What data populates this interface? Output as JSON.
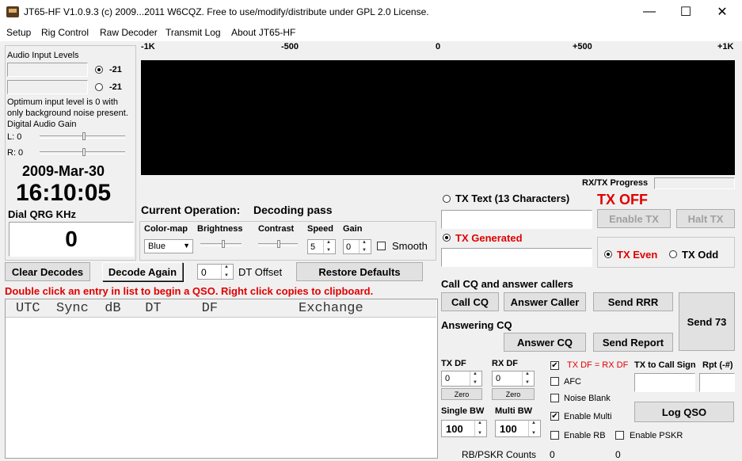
{
  "window": {
    "title": "JT65-HF V1.0.9.3 (c) 2009...2011 W6CQZ.  Free to use/modify/distribute under GPL 2.0 License.",
    "minimize": "—",
    "maximize": "☐",
    "close": "✕"
  },
  "menu": [
    "Setup",
    "Rig Control",
    "Raw Decoder",
    "Transmit Log",
    "About JT65-HF"
  ],
  "audio": {
    "title": "Audio Input Levels",
    "level1": "-21",
    "level2": "-21",
    "note": "Optimum input level is 0 with only background noise present.",
    "gain_title": "Digital Audio Gain",
    "left_label": "L: 0",
    "right_label": "R: 0"
  },
  "clock": {
    "date": "2009-Mar-30",
    "time": "16:10:05",
    "dial_label": "Dial QRG KHz",
    "dial_value": "0"
  },
  "waterfall": {
    "scale": [
      "-1K",
      "-500",
      "0",
      "+500",
      "+1K"
    ],
    "progress_label": "RX/TX Progress"
  },
  "operation": {
    "label": "Current Operation:",
    "value": "Decoding pass"
  },
  "controls": {
    "colormap_label": "Color-map",
    "colormap_value": "Blue",
    "brightness_label": "Brightness",
    "contrast_label": "Contrast",
    "speed_label": "Speed",
    "speed_value": "5",
    "gain_label": "Gain",
    "gain_value": "0",
    "smooth_label": "Smooth"
  },
  "decode": {
    "clear": "Clear Decodes",
    "again": "Decode Again",
    "dt_value": "0",
    "dt_label": "DT Offset",
    "restore": "Restore Defaults",
    "hint": "Double click an entry in list to begin a QSO.  Right click copies to clipboard.",
    "columns": "UTC  Sync  dB   DT     DF          Exchange"
  },
  "tx": {
    "text_label": "TX Text (13 Characters)",
    "status": "TX OFF",
    "enable": "Enable TX",
    "halt": "Halt TX",
    "generated_label": "TX Generated",
    "even": "TX Even",
    "odd": "TX Odd"
  },
  "cq": {
    "title": "Call CQ and answer callers",
    "call_cq": "Call CQ",
    "answer_caller": "Answer Caller",
    "send_rrr": "Send RRR",
    "send73": "Send 73",
    "answering_title": "Answering CQ",
    "answer_cq": "Answer CQ",
    "send_report": "Send Report"
  },
  "tuning": {
    "txdf_label": "TX DF",
    "txdf_value": "0",
    "rxdf_label": "RX DF",
    "rxdf_value": "0",
    "zero": "Zero",
    "txeqrx": "TX DF = RX DF",
    "afc": "AFC",
    "noise_blank": "Noise Blank",
    "enable_multi": "Enable Multi",
    "single_bw_label": "Single BW",
    "single_bw": "100",
    "multi_bw_label": "Multi BW",
    "multi_bw": "100",
    "to_call_label": "TX to Call Sign",
    "rpt_label": "Rpt (-#)",
    "log_qso": "Log QSO",
    "enable_rb": "Enable RB",
    "enable_pskr": "Enable PSKR",
    "counts_label": "RB/PSKR Counts",
    "rb_count": "0",
    "pskr_count": "0"
  },
  "colors": {
    "waterfall": "#000000",
    "alert": "#e00000"
  }
}
